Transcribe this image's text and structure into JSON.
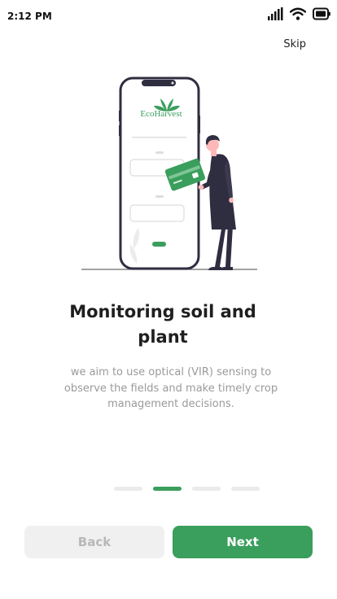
{
  "status_bar": {
    "time": "2:12 PM",
    "icons": [
      "cellular-signal-icon",
      "wifi-icon",
      "battery-icon"
    ]
  },
  "header": {
    "skip_label": "Skip"
  },
  "illustration": {
    "brand_text": "EcoHarvest",
    "icons": [
      "leaf-logo-icon",
      "credit-card-icon"
    ]
  },
  "onboarding": {
    "title": "Monitoring soil and plant",
    "description": "we aim to use optical (VIR) sensing to observe the fields and make timely crop management decisions.",
    "page_count": 4,
    "active_page": 2
  },
  "footer": {
    "back_label": "Back",
    "next_label": "Next"
  },
  "colors": {
    "accent": "#3a9e5c",
    "text_dark": "#1f1f1f",
    "text_muted": "#9a9a9a",
    "disabled_bg": "#f0f0f0",
    "illustration_dark": "#2f2e41"
  }
}
